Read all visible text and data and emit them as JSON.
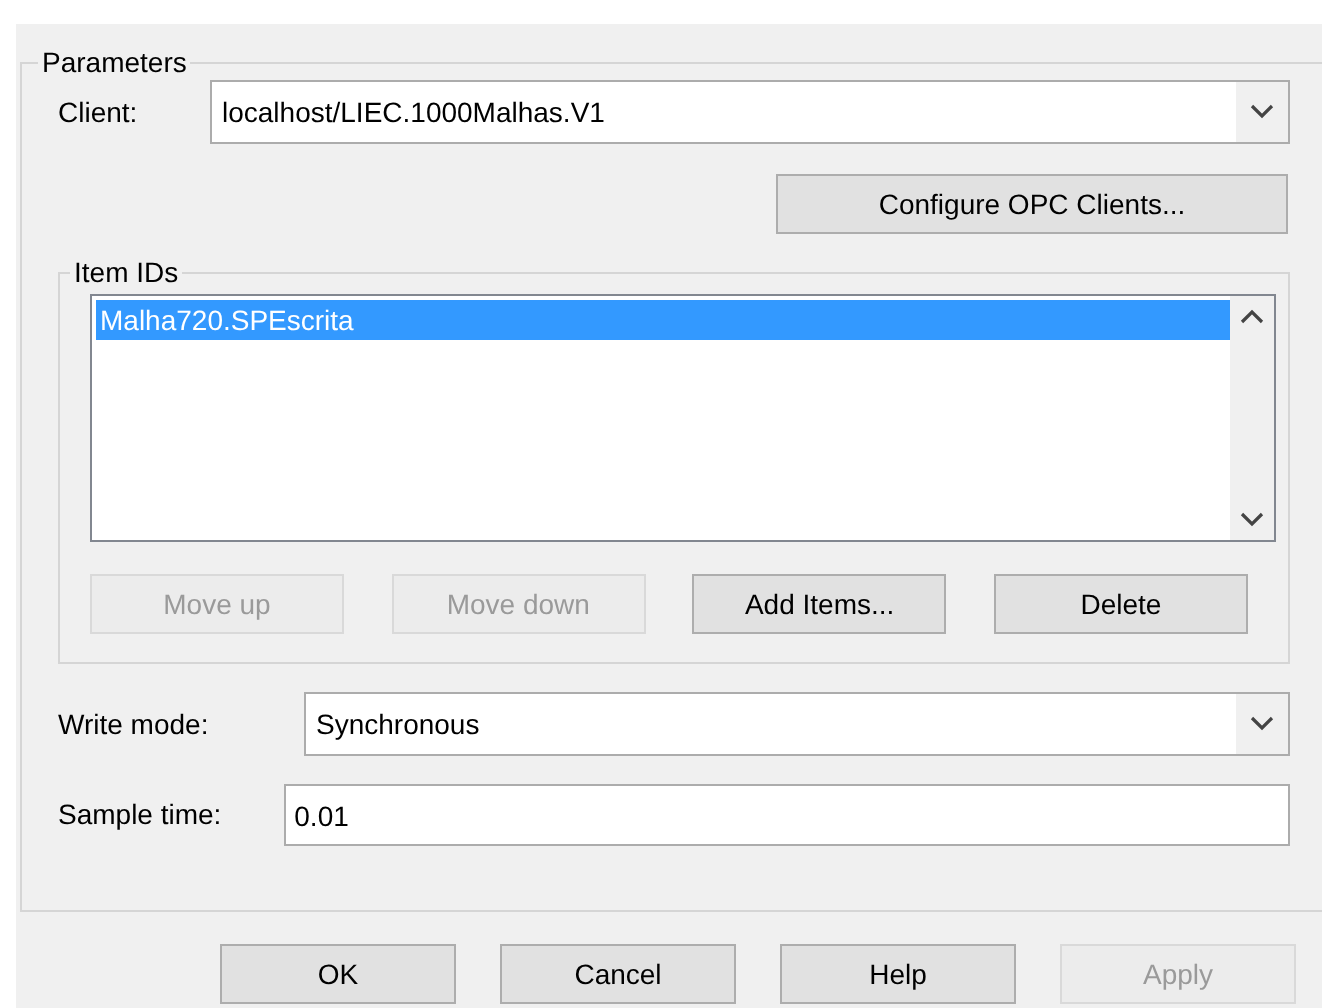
{
  "parameters": {
    "title": "Parameters",
    "client": {
      "label": "Client:",
      "value": "localhost/LIEC.1000Malhas.V1"
    },
    "configure_button": "Configure OPC Clients...",
    "item_ids": {
      "title": "Item IDs",
      "items": [
        {
          "text": "Malha720.SPEscrita",
          "selected": true
        }
      ],
      "buttons": [
        {
          "label": "Move up",
          "disabled": true
        },
        {
          "label": "Move down",
          "disabled": true
        },
        {
          "label": "Add Items...",
          "disabled": false
        },
        {
          "label": "Delete",
          "disabled": false
        }
      ]
    },
    "write_mode": {
      "label": "Write mode:",
      "value": "Synchronous"
    },
    "sample_time": {
      "label": "Sample time:",
      "value": "0.01"
    }
  },
  "buttons": [
    {
      "label": "OK",
      "disabled": false
    },
    {
      "label": "Cancel",
      "disabled": false
    },
    {
      "label": "Help",
      "disabled": false
    },
    {
      "label": "Apply",
      "disabled": true
    }
  ]
}
